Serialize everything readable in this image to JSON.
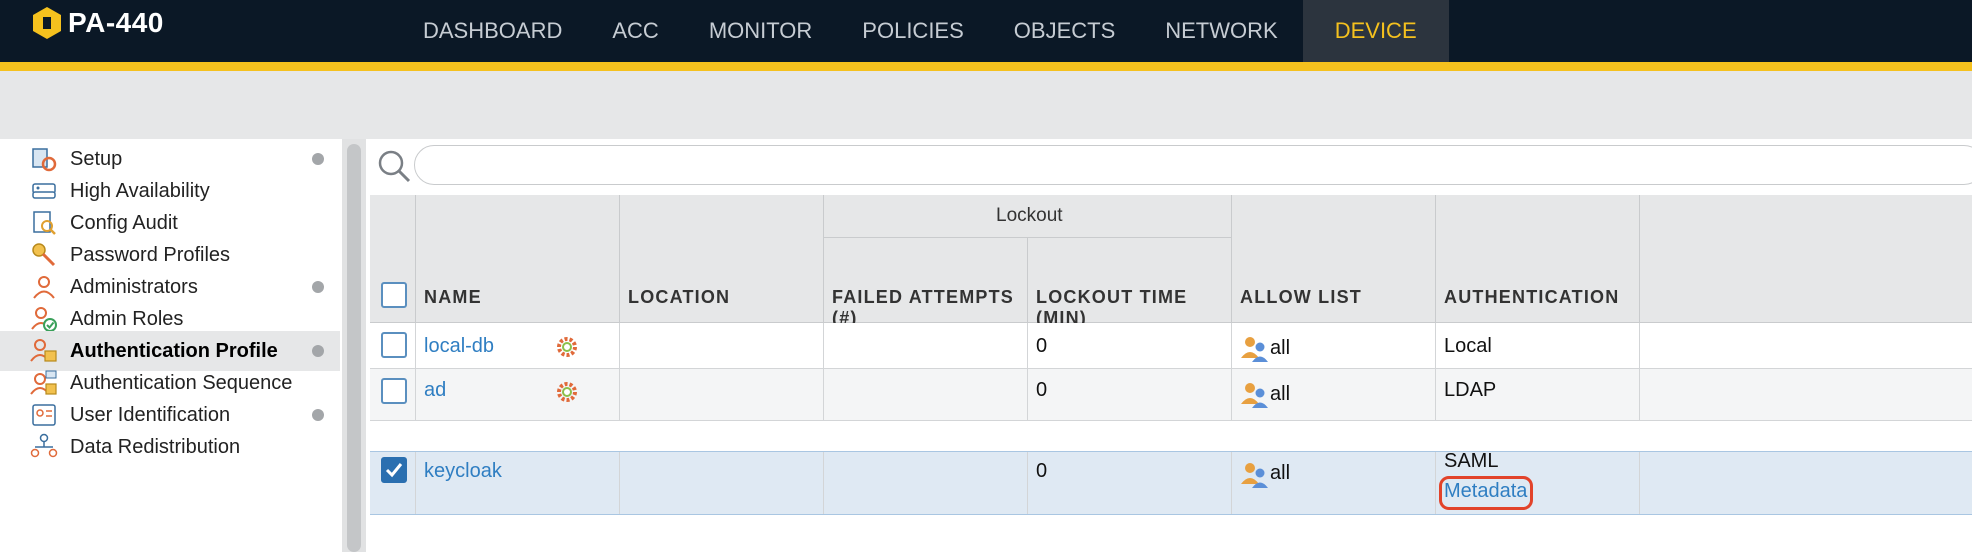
{
  "app": {
    "title": "PA-440"
  },
  "nav": [
    {
      "label": "DASHBOARD"
    },
    {
      "label": "ACC"
    },
    {
      "label": "MONITOR"
    },
    {
      "label": "POLICIES"
    },
    {
      "label": "OBJECTS"
    },
    {
      "label": "NETWORK"
    },
    {
      "label": "DEVICE",
      "active": true
    }
  ],
  "sidebar": {
    "items": [
      {
        "label": "Setup",
        "dot": true
      },
      {
        "label": "High Availability",
        "dot": false
      },
      {
        "label": "Config Audit",
        "dot": false
      },
      {
        "label": "Password Profiles",
        "dot": false
      },
      {
        "label": "Administrators",
        "dot": true
      },
      {
        "label": "Admin Roles",
        "dot": false
      },
      {
        "label": "Authentication Profile",
        "dot": true,
        "active": true
      },
      {
        "label": "Authentication Sequence",
        "dot": false
      },
      {
        "label": "User Identification",
        "dot": true
      },
      {
        "label": "Data Redistribution",
        "dot": false
      }
    ]
  },
  "search": {
    "placeholder": ""
  },
  "table": {
    "group_header": "Lockout",
    "columns": {
      "name": "NAME",
      "location": "LOCATION",
      "failed": "FAILED ATTEMPTS (#)",
      "lockout_time": "LOCKOUT TIME (MIN)",
      "allow_list": "ALLOW LIST",
      "authentication": "AUTHENTICATION"
    },
    "rows": [
      {
        "name": "local-db",
        "location": "",
        "failed": "",
        "lockout_time": "0",
        "allow_list": "all",
        "authentication": "Local",
        "checked": false
      },
      {
        "name": "ad",
        "location": "",
        "failed": "",
        "lockout_time": "0",
        "allow_list": "all",
        "authentication": "LDAP",
        "checked": false
      },
      {
        "name": "keycloak",
        "location": "",
        "failed": "",
        "lockout_time": "0",
        "allow_list": "all",
        "authentication": "SAML",
        "metadata": "Metadata",
        "checked": true
      }
    ]
  },
  "colors": {
    "accent": "#f5c11e",
    "topbar": "#0b1826",
    "link": "#2f7ec2",
    "highlight": "#e2432a"
  }
}
